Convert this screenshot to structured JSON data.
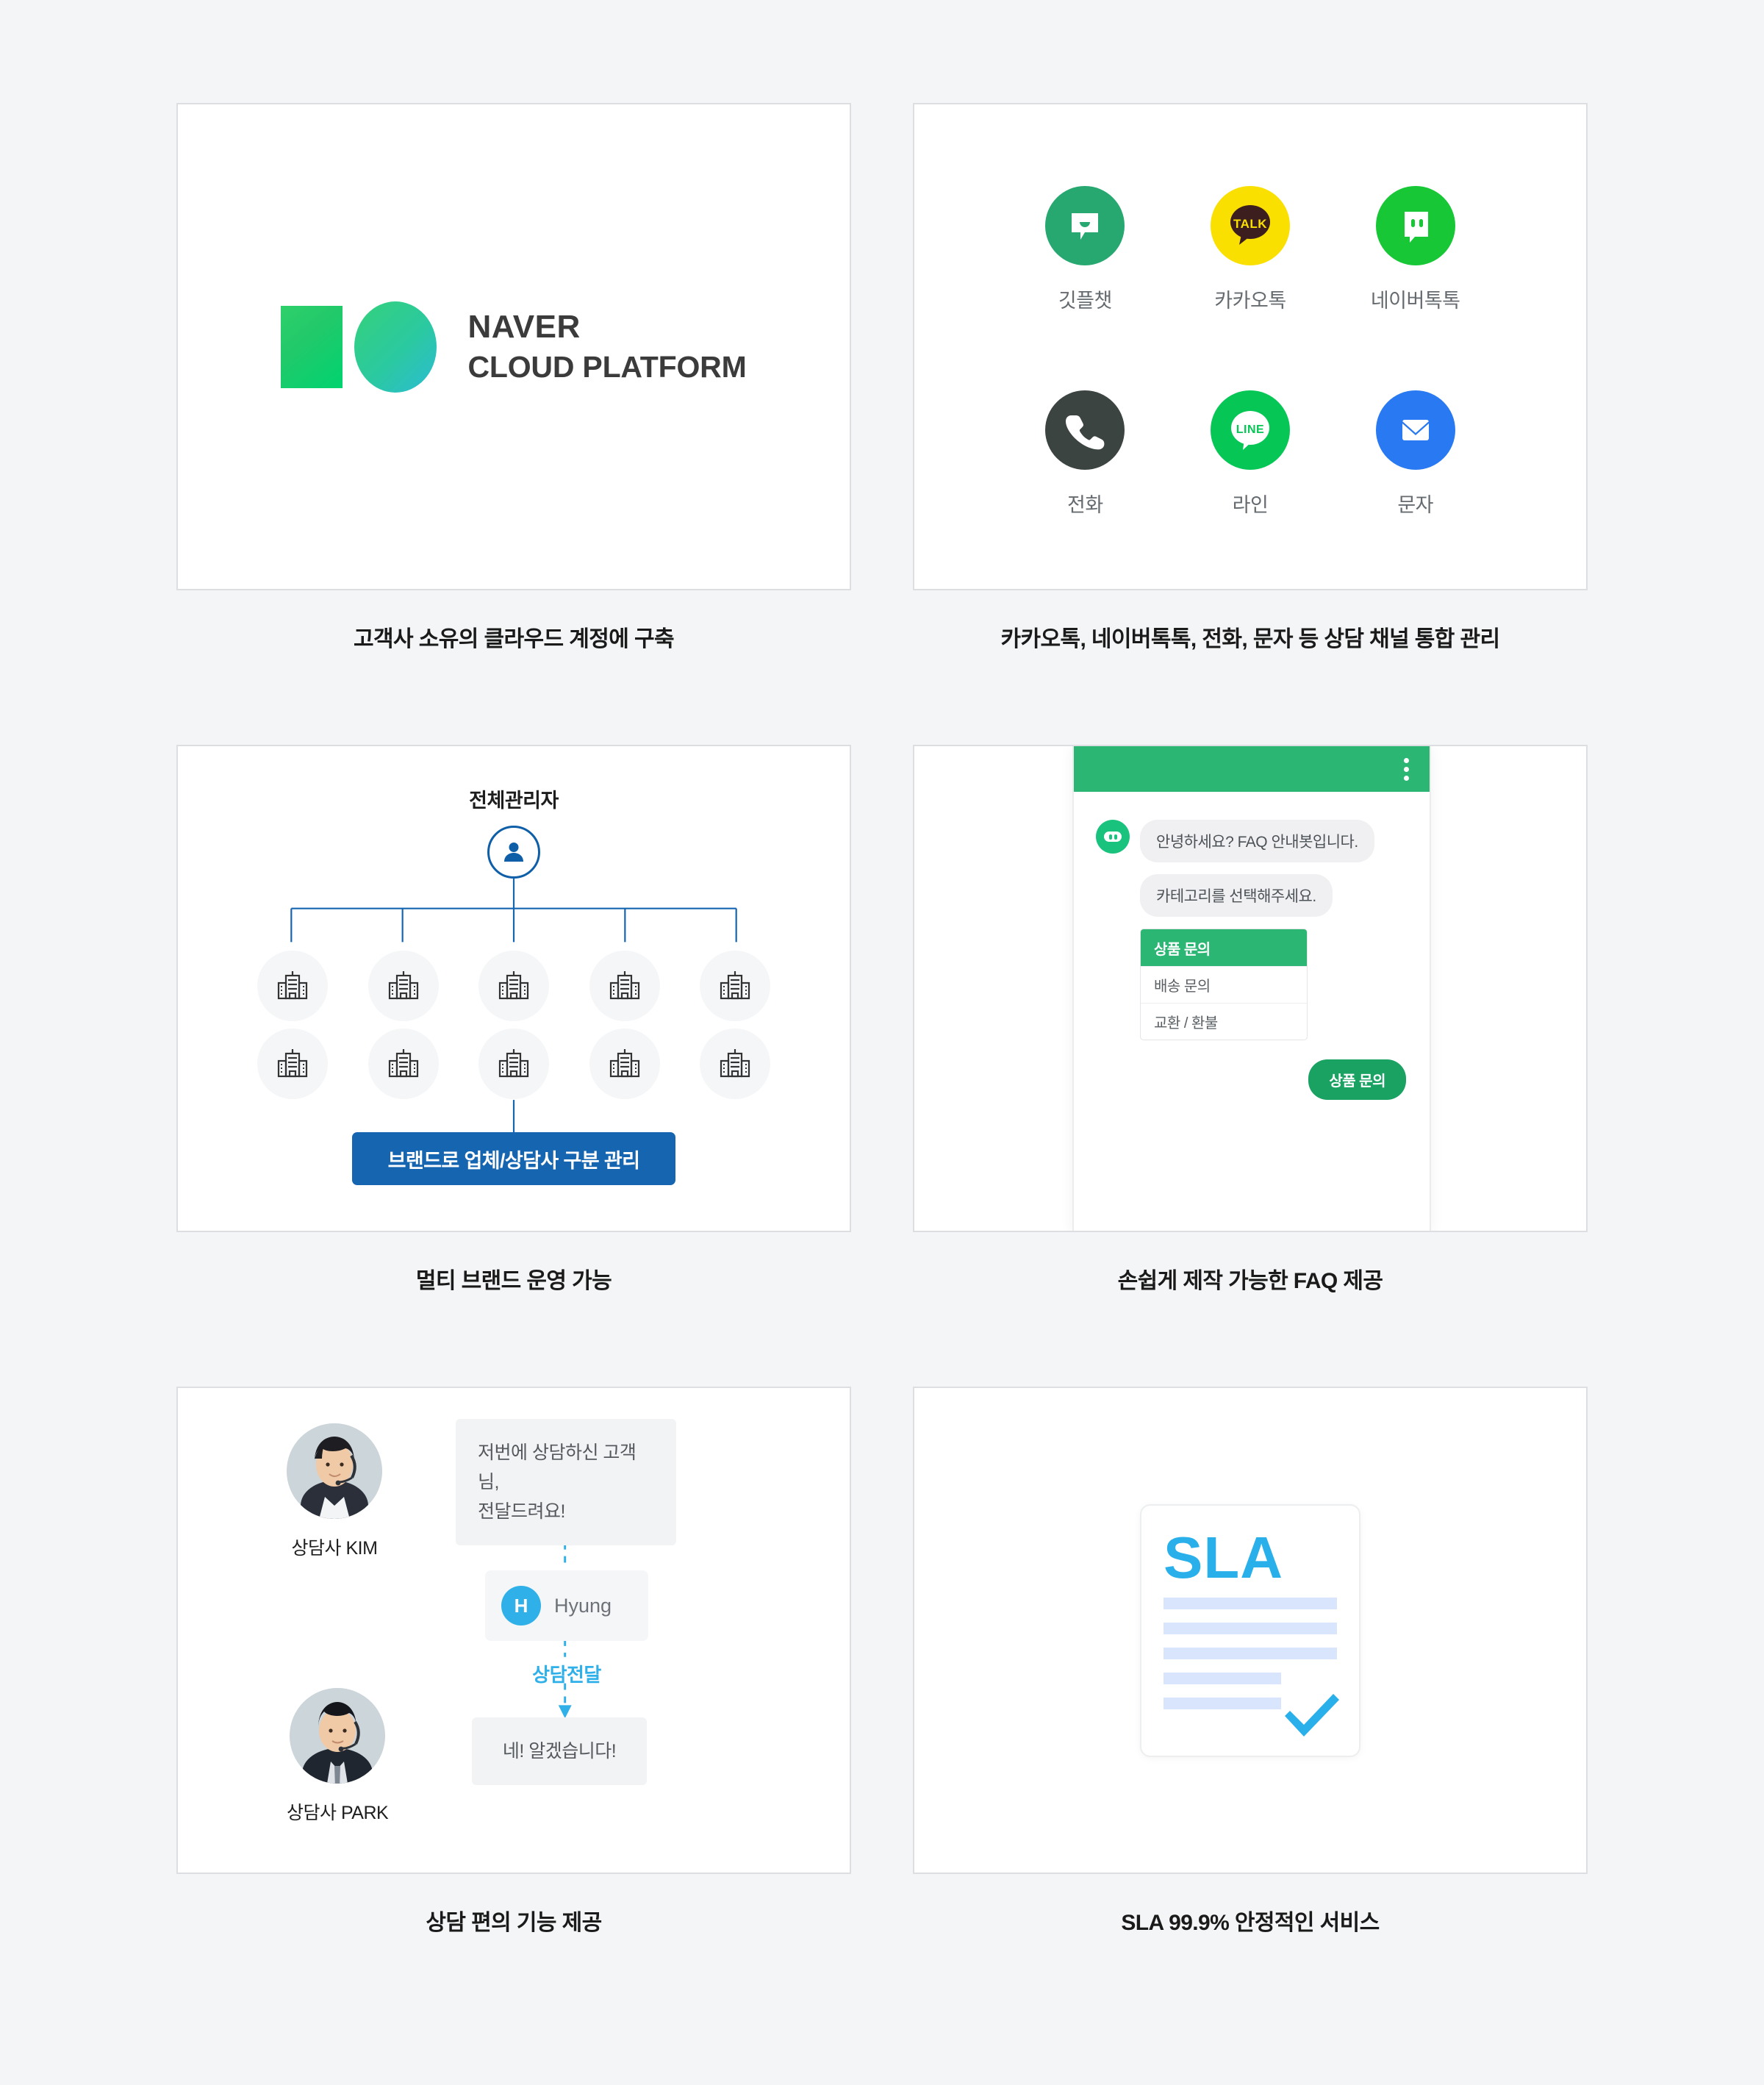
{
  "cards": [
    {
      "id": "cloud-account",
      "caption": "고객사 소유의 클라우드 계정에 구축",
      "logo": {
        "line1": "NAVER",
        "line2": "CLOUD PLATFORM"
      }
    },
    {
      "id": "channels",
      "caption": "카카오톡, 네이버톡톡, 전화, 문자 등 상담 채널 통합 관리",
      "items": [
        {
          "label": "깃플챗",
          "icon": "gitple-chat-icon",
          "color": "#28a871"
        },
        {
          "label": "카카오톡",
          "icon": "kakaotalk-icon",
          "color": "#f9e000",
          "mark": "TALK"
        },
        {
          "label": "네이버톡톡",
          "icon": "navertalk-icon",
          "color": "#17c736"
        },
        {
          "label": "전화",
          "icon": "phone-icon",
          "color": "#3b4441"
        },
        {
          "label": "라인",
          "icon": "line-icon",
          "color": "#06c755",
          "mark": "LINE"
        },
        {
          "label": "문자",
          "icon": "sms-icon",
          "color": "#2979f2"
        }
      ]
    },
    {
      "id": "multi-brand",
      "caption": "멀티 브랜드 운영 가능",
      "org": {
        "root_label": "전체관리자",
        "node_count_row1": 5,
        "node_count_row2": 5,
        "button_label": "브랜드로 업체/상담사 구분 관리",
        "button_color": "#1565b0"
      }
    },
    {
      "id": "faq",
      "caption": "손쉽게 제작 가능한 FAQ 제공",
      "chat": {
        "header_color": "#2bb673",
        "messages": [
          "안녕하세요? FAQ 안내봇입니다.",
          "카테고리를 선택해주세요."
        ],
        "options": [
          {
            "label": "상품 문의",
            "selected": true
          },
          {
            "label": "배송 문의",
            "selected": false
          },
          {
            "label": "교환 / 환불",
            "selected": false
          }
        ],
        "reply": "상품 문의"
      }
    },
    {
      "id": "transfer",
      "caption": "상담 편의 기능 제공",
      "transfer": {
        "agent_a": "상담사 KIM",
        "agent_b": "상담사 PARK",
        "message_a_line1": "저번에 상담하신 고객님,",
        "message_a_line2": "전달드려요!",
        "operator_initial": "H",
        "operator_name": "Hyung",
        "action_label": "상담전달",
        "action_color": "#2fb0e8",
        "message_b": "네! 알겠습니다!"
      }
    },
    {
      "id": "sla",
      "caption": "SLA 99.9% 안정적인 서비스",
      "sla": {
        "title": "SLA",
        "accent_color": "#29b0ea",
        "line_color": "#d9e4fd",
        "line_count": 5
      }
    }
  ]
}
